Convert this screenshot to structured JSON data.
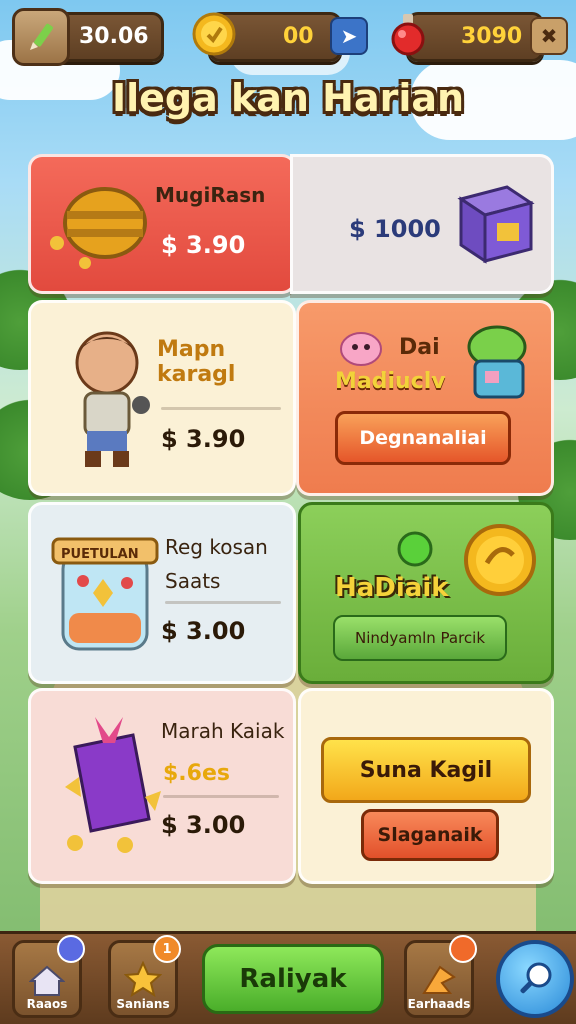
{
  "topbar": {
    "left_value": "30.06",
    "coin_value": "00",
    "gem_value": "3090"
  },
  "title": "Ilega kan Harian",
  "cards": {
    "c1_name": "MugiRasn",
    "c1_price": "$ 3.90",
    "c2_price": "$ 1000",
    "c3_name": "Mapn karagl",
    "c3_price": "$ 3.90",
    "c4_line1": "Dai",
    "c4_line2": "Madiuclv",
    "c4_button": "Degnanaliai",
    "c5_banner": "PUETULAN",
    "c5_name1": "Reg kosan",
    "c5_name2": "Saats",
    "c5_price": "$ 3.00",
    "c6_name": "HaDiaik",
    "c6_button": "Nindyamln Parcik",
    "c7_name": "Marah Kaiak",
    "c7_sub": "$.6es",
    "c7_price": "$ 3.00",
    "c8_button1": "Suna Kagil",
    "c8_button2": "Slaganaik"
  },
  "nav": {
    "home_label": "Raaos",
    "star_label": "Sanians",
    "center_label": "Raliyak",
    "event_label": "Earhaads",
    "star_badge": "1"
  },
  "colors": {
    "accent_red": "#ef5a4e",
    "accent_orange": "#f2835a",
    "accent_green": "#7ab84a",
    "button_green": "#5cbf3a"
  }
}
